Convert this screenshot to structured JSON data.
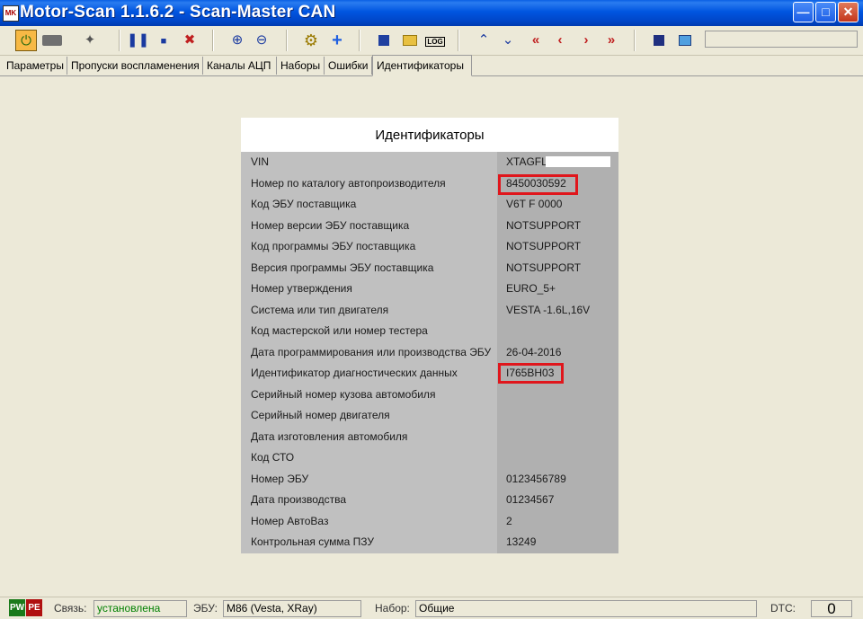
{
  "window": {
    "title": "Motor-Scan 1.1.6.2 - Scan-Master CAN",
    "icon_text": "MK"
  },
  "toolbar": {
    "icons": [
      "connect-icon",
      "ecu-icon",
      "tools-icon",
      "pause-icon",
      "stop-icon",
      "clear-icon",
      "zoom-in-icon",
      "zoom-out-icon",
      "settings-gear-icon",
      "add-icon",
      "save-icon",
      "open-folder-icon",
      "log-icon",
      "arrow-up-icon",
      "arrow-down-icon",
      "double-left-icon",
      "left-icon",
      "right-icon",
      "double-right-icon",
      "save-disk-icon",
      "export-icon"
    ],
    "log_label": "LOG"
  },
  "tabs": [
    {
      "label": "Параметры",
      "active": false
    },
    {
      "label": "Пропуски воспламенения",
      "active": false
    },
    {
      "label": "Каналы АЦП",
      "active": false
    },
    {
      "label": "Наборы",
      "active": false
    },
    {
      "label": "Ошибки",
      "active": false
    },
    {
      "label": "Идентификаторы",
      "active": true
    }
  ],
  "panel": {
    "title": "Идентификаторы",
    "rows": [
      {
        "label": "VIN",
        "value": "XTAGFL"
      },
      {
        "label": "Номер по каталогу автопроизводителя",
        "value": "8450030592"
      },
      {
        "label": "Код ЭБУ поставщика",
        "value": "V6T F 0000"
      },
      {
        "label": "Номер версии ЭБУ поставщика",
        "value": "NOTSUPPORT"
      },
      {
        "label": "Код программы ЭБУ поставщика",
        "value": "NOTSUPPORT"
      },
      {
        "label": "Версия программы ЭБУ поставщика",
        "value": "NOTSUPPORT"
      },
      {
        "label": "Номер утверждения",
        "value": "EURO_5+"
      },
      {
        "label": "Система или тип двигателя",
        "value": "VESTA -1.6L,16V"
      },
      {
        "label": "Код мастерской или номер тестера",
        "value": ""
      },
      {
        "label": "Дата программирования или производства ЭБУ",
        "value": "26-04-2016"
      },
      {
        "label": "Идентификатор диагностических данных",
        "value": "I765BH03"
      },
      {
        "label": "Серийный номер кузова автомобиля",
        "value": ""
      },
      {
        "label": "Серийный номер двигателя",
        "value": ""
      },
      {
        "label": "Дата изготовления автомобиля",
        "value": ""
      },
      {
        "label": "Код СТО",
        "value": ""
      },
      {
        "label": "Номер ЭБУ",
        "value": "0123456789"
      },
      {
        "label": "Дата производства",
        "value": "01234567"
      },
      {
        "label": "Номер АвтоВаз",
        "value": "2"
      },
      {
        "label": "Контрольная сумма ПЗУ",
        "value": "13249"
      }
    ]
  },
  "status": {
    "indicator1": "PW",
    "indicator2": "PE",
    "link_label": "Связь:",
    "link_value": "установлена",
    "ecu_label": "ЭБУ:",
    "ecu_value": "M86 (Vesta, XRay)",
    "set_label": "Набор:",
    "set_value": "Общие",
    "dtc_label": "DTC:",
    "dtc_value": "0"
  },
  "colors": {
    "highlight_box": "#e0161c",
    "link_value": "#008000"
  }
}
